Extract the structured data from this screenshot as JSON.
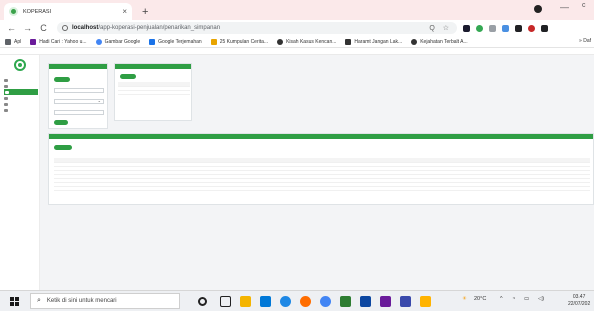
{
  "browser": {
    "tab_title": "KOPERASI",
    "tab_close": "×",
    "new_tab": "+",
    "nav_back": "←",
    "nav_forward": "→",
    "nav_reload": "C",
    "url_host": "localhost",
    "url_path": "/app-koperasi-penjualan/penarikan_simpanan",
    "omnibox_right": "Q ☆",
    "minimize": "—",
    "accent": "#2f9e44"
  },
  "bookmarks": [
    {
      "label": "Apl",
      "icon": "apps-icon",
      "color": "#5f6368"
    },
    {
      "label": "Hadi Cari : Yahoo u...",
      "icon": "yahoo-icon",
      "color": "#6a1b9a"
    },
    {
      "label": "Gambar Google",
      "icon": "google-icon",
      "color": "#4285f4"
    },
    {
      "label": "Google Terjemahan",
      "icon": "translate-icon",
      "color": "#1a73e8"
    },
    {
      "label": "25 Kumpulan Cerita...",
      "icon": "star-icon",
      "color": "#e8a400"
    },
    {
      "label": "Kisah Kasus Kencan...",
      "icon": "globe-icon",
      "color": "#333333"
    },
    {
      "label": "Haramt Jangan Lak...",
      "icon": "bookmark-icon",
      "color": "#333333"
    },
    {
      "label": "Kejahatan Terbalt A...",
      "icon": "globe-icon",
      "color": "#333333"
    }
  ],
  "bookmarks_right": "» Daf",
  "taskbar": {
    "search_placeholder": "Ketik di sini untuk mencari",
    "temperature": "20°C",
    "time": "03.47",
    "date": "22/07/202"
  }
}
